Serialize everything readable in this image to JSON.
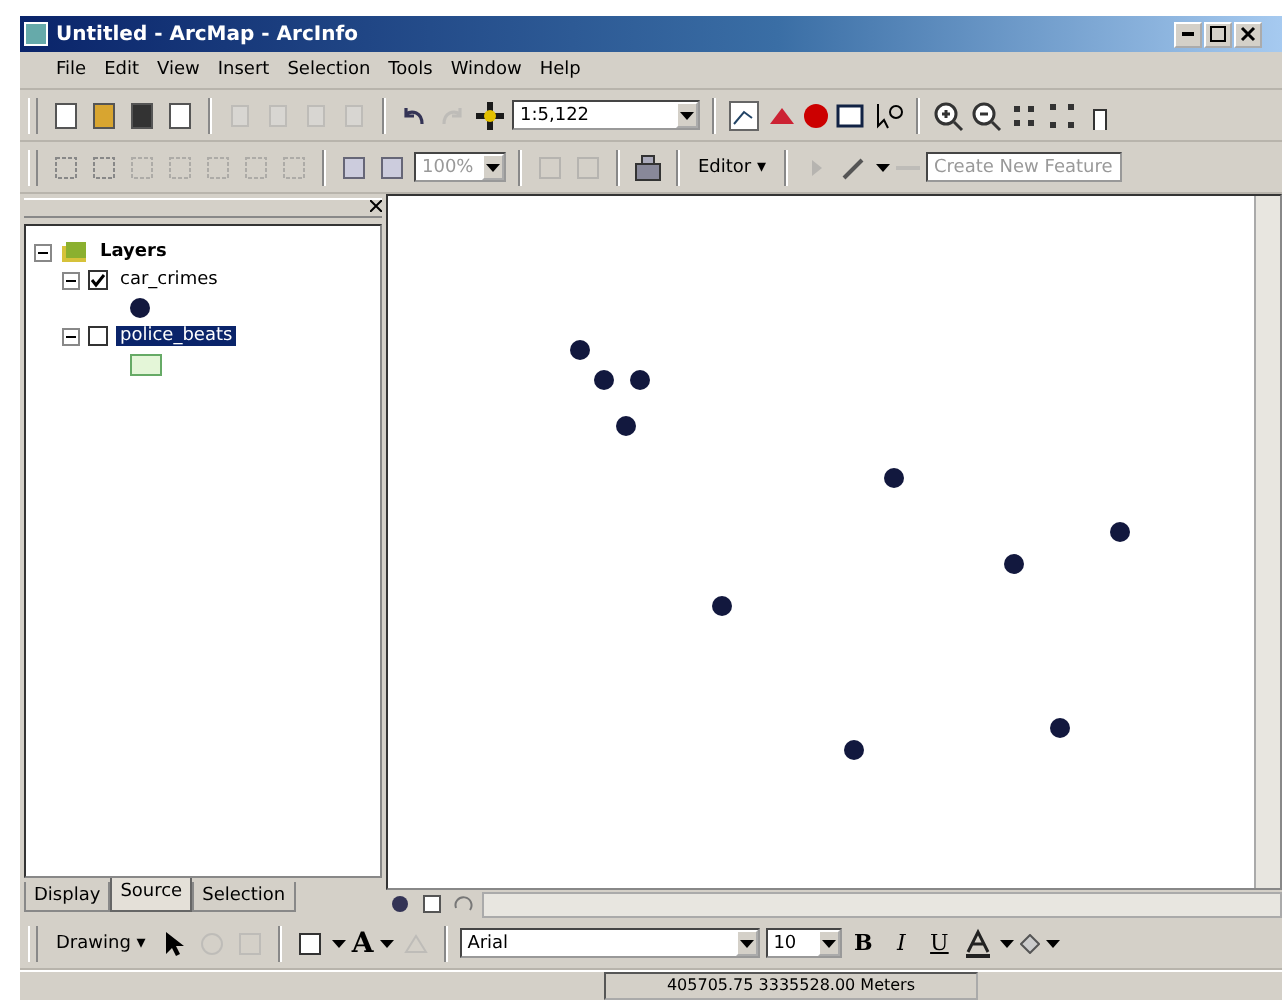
{
  "window": {
    "title": "Untitled - ArcMap - ArcInfo"
  },
  "menu": [
    {
      "label": "File"
    },
    {
      "label": "Edit"
    },
    {
      "label": "View"
    },
    {
      "label": "Insert"
    },
    {
      "label": "Selection"
    },
    {
      "label": "Tools"
    },
    {
      "label": "Window"
    },
    {
      "label": "Help"
    }
  ],
  "standard_toolbar": {
    "scale": "1:5,122"
  },
  "editor_toolbar": {
    "zoom": "100%",
    "editor_menu": "Editor ▾",
    "task": "Create New Feature"
  },
  "toc": {
    "root": {
      "label": "Layers",
      "expanded": true,
      "children": [
        {
          "label": "car_crimes",
          "checked": true,
          "selected": false,
          "expanded": true,
          "kind": "point"
        },
        {
          "label": "police_beats",
          "checked": false,
          "selected": true,
          "expanded": true,
          "kind": "polygon"
        }
      ]
    },
    "tabs": [
      {
        "label": "Display",
        "selected": false
      },
      {
        "label": "Source",
        "selected": true
      },
      {
        "label": "Selection",
        "selected": false
      }
    ]
  },
  "drawing_toolbar": {
    "menu": "Drawing ▾",
    "font": "Arial",
    "size": "10",
    "bold": "B",
    "italic": "I",
    "underline": "U",
    "text_symbol": "A"
  },
  "status_bar": {
    "coordinates": "405705.75  3335528.00 Meters"
  }
}
